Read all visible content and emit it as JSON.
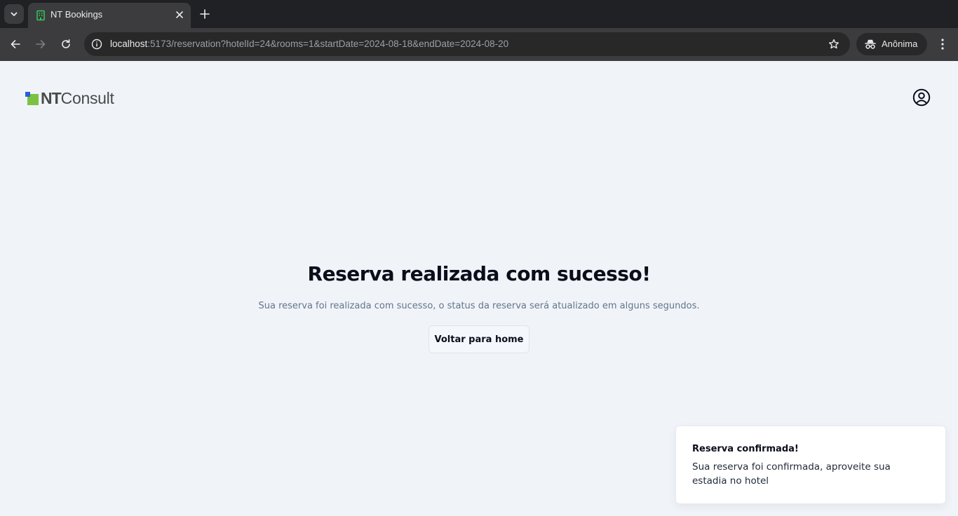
{
  "browser": {
    "tab": {
      "title": "NT Bookings",
      "favicon": "building-icon"
    },
    "url": {
      "host": "localhost",
      "path": ":5173/reservation?hotelId=24&rooms=1&startDate=2024-08-18&endDate=2024-08-20"
    },
    "profile_label": "Anônima",
    "icons": [
      "tab-search-icon",
      "close-icon",
      "plus-icon",
      "back-arrow-icon",
      "forward-arrow-icon",
      "reload-icon",
      "info-icon",
      "star-icon",
      "incognito-icon",
      "kebab-menu-icon"
    ]
  },
  "header": {
    "logo": {
      "bold_part": "NT",
      "regular_part": "Consult",
      "colors": {
        "blue": "#2e5bd9",
        "green": "#7cc242"
      }
    },
    "user_icon": "user-circle-icon"
  },
  "main": {
    "title": "Reserva realizada com sucesso!",
    "description": "Sua reserva foi realizada com sucesso, o status da reserva será atualizado em alguns segundos.",
    "home_button_label": "Voltar para home"
  },
  "toast": {
    "title": "Reserva confirmada!",
    "message": "Sua reserva foi confirmada, aproveite sua estadia no hotel"
  }
}
